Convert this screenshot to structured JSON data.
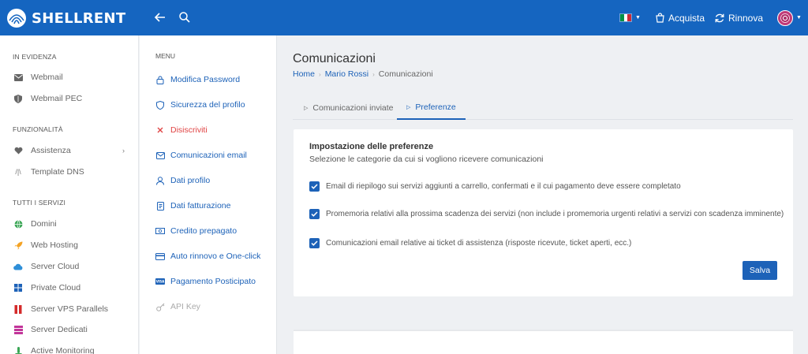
{
  "header": {
    "brand": "SHELLRENT",
    "buy_label": "Acquista",
    "renew_label": "Rinnova",
    "colors": {
      "bar": "#1565c0",
      "accent": "#1d62b8"
    }
  },
  "sidebar": {
    "sections": [
      {
        "label": "IN EVIDENZA"
      },
      {
        "label": "FUNZIONALITÀ"
      },
      {
        "label": "TUTTI I SERVIZI"
      }
    ],
    "items": [
      {
        "label": "Webmail",
        "icon": "envelope-icon"
      },
      {
        "label": "Webmail PEC",
        "icon": "shield-icon"
      },
      {
        "label": "Assistenza",
        "icon": "heart-icon"
      },
      {
        "label": "Template DNS",
        "icon": "dns-icon"
      },
      {
        "label": "Domini",
        "icon": "globe-icon"
      },
      {
        "label": "Web Hosting",
        "icon": "rocket-icon"
      },
      {
        "label": "Server Cloud",
        "icon": "cloud-icon"
      },
      {
        "label": "Private Cloud",
        "icon": "windows-icon"
      },
      {
        "label": "Server VPS Parallels",
        "icon": "parallels-icon"
      },
      {
        "label": "Server Dedicati",
        "icon": "server-icon"
      },
      {
        "label": "Active Monitoring",
        "icon": "monitor-icon"
      }
    ]
  },
  "menu": {
    "title": "MENU",
    "items": [
      {
        "label": "Modifica Password",
        "icon": "lock-icon"
      },
      {
        "label": "Sicurezza del profilo",
        "icon": "shield-icon"
      },
      {
        "label": "Disiscriviti",
        "icon": "close-icon"
      },
      {
        "label": "Comunicazioni email",
        "icon": "envelope-icon"
      },
      {
        "label": "Dati profilo",
        "icon": "user-icon"
      },
      {
        "label": "Dati fatturazione",
        "icon": "invoice-icon"
      },
      {
        "label": "Credito prepagato",
        "icon": "money-icon"
      },
      {
        "label": "Auto rinnovo e One-click",
        "icon": "card-icon"
      },
      {
        "label": "Pagamento Posticipato",
        "icon": "visa-icon"
      },
      {
        "label": "API Key",
        "icon": "key-icon"
      }
    ]
  },
  "main": {
    "title": "Comunicazioni",
    "breadcrumb": [
      "Home",
      "Mario Rossi",
      "Comunicazioni"
    ],
    "tabs": [
      {
        "label": "Comunicazioni inviate"
      },
      {
        "label": "Preferenze"
      }
    ],
    "card": {
      "title": "Impostazione delle preferenze",
      "subtitle": "Selezione le categorie da cui si vogliono ricevere comunicazioni",
      "options": [
        {
          "label": "Email di riepilogo sui servizi aggiunti a carrello, confermati e il cui pagamento deve essere completato",
          "checked": true
        },
        {
          "label": "Promemoria relativi alla prossima scadenza dei servizi (non include i promemoria urgenti relativi a servizi con scadenza imminente)",
          "checked": true
        },
        {
          "label": "Comunicazioni email relative ai ticket di assistenza (risposte ricevute, ticket aperti, ecc.)",
          "checked": true
        }
      ],
      "save_label": "Salva"
    }
  }
}
